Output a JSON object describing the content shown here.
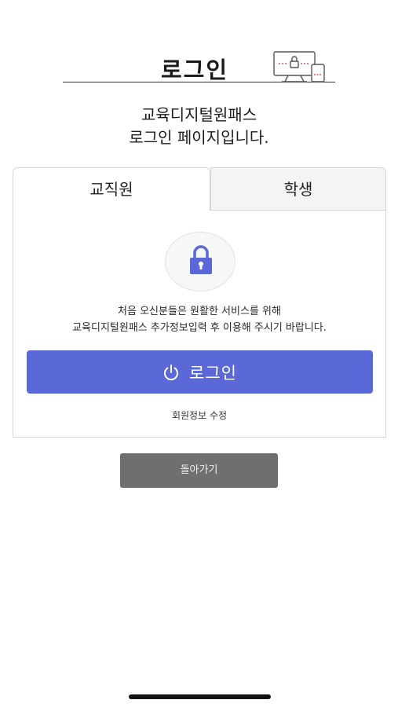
{
  "header": {
    "title": "로그인"
  },
  "subtitle": {
    "line1": "교육디지털원패스",
    "line2": "로그인 페이지입니다."
  },
  "tabs": [
    {
      "label": "교직원",
      "active": true
    },
    {
      "label": "학생",
      "active": false
    }
  ],
  "notice": {
    "line1": "처음 오신분들은 원활한 서비스를 위해",
    "line2": "교육디지털원패스 추가정보입력 후 이용해 주시기 바랍니다."
  },
  "login_button": {
    "label": "로그인",
    "icon": "power-icon"
  },
  "edit_link": {
    "label": "회원정보 수정"
  },
  "back_button": {
    "label": "돌아가기"
  },
  "colors": {
    "accent": "#5b68d8",
    "back_button": "#6f6f6f"
  }
}
